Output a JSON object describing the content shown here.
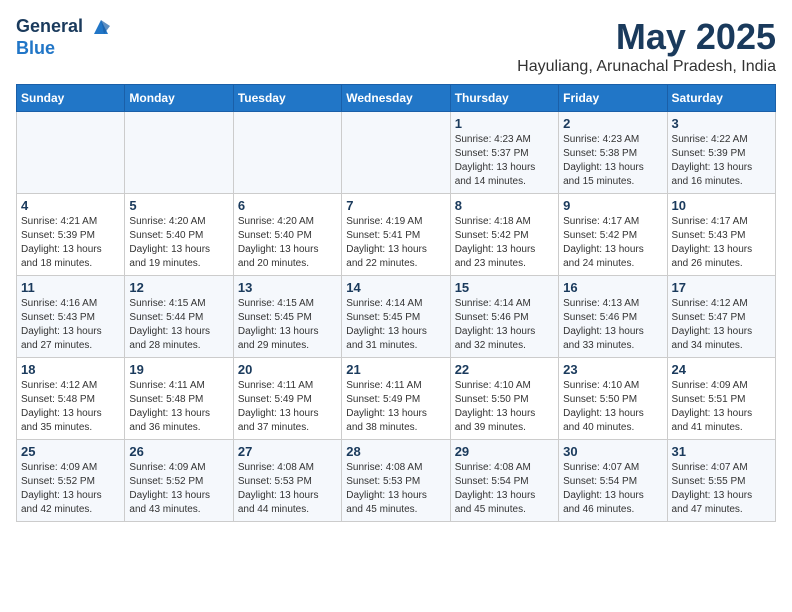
{
  "logo": {
    "line1": "General",
    "line2": "Blue"
  },
  "title": "May 2025",
  "location": "Hayuliang, Arunachal Pradesh, India",
  "weekdays": [
    "Sunday",
    "Monday",
    "Tuesday",
    "Wednesday",
    "Thursday",
    "Friday",
    "Saturday"
  ],
  "weeks": [
    [
      {
        "day": "",
        "detail": ""
      },
      {
        "day": "",
        "detail": ""
      },
      {
        "day": "",
        "detail": ""
      },
      {
        "day": "",
        "detail": ""
      },
      {
        "day": "1",
        "detail": "Sunrise: 4:23 AM\nSunset: 5:37 PM\nDaylight: 13 hours\nand 14 minutes."
      },
      {
        "day": "2",
        "detail": "Sunrise: 4:23 AM\nSunset: 5:38 PM\nDaylight: 13 hours\nand 15 minutes."
      },
      {
        "day": "3",
        "detail": "Sunrise: 4:22 AM\nSunset: 5:39 PM\nDaylight: 13 hours\nand 16 minutes."
      }
    ],
    [
      {
        "day": "4",
        "detail": "Sunrise: 4:21 AM\nSunset: 5:39 PM\nDaylight: 13 hours\nand 18 minutes."
      },
      {
        "day": "5",
        "detail": "Sunrise: 4:20 AM\nSunset: 5:40 PM\nDaylight: 13 hours\nand 19 minutes."
      },
      {
        "day": "6",
        "detail": "Sunrise: 4:20 AM\nSunset: 5:40 PM\nDaylight: 13 hours\nand 20 minutes."
      },
      {
        "day": "7",
        "detail": "Sunrise: 4:19 AM\nSunset: 5:41 PM\nDaylight: 13 hours\nand 22 minutes."
      },
      {
        "day": "8",
        "detail": "Sunrise: 4:18 AM\nSunset: 5:42 PM\nDaylight: 13 hours\nand 23 minutes."
      },
      {
        "day": "9",
        "detail": "Sunrise: 4:17 AM\nSunset: 5:42 PM\nDaylight: 13 hours\nand 24 minutes."
      },
      {
        "day": "10",
        "detail": "Sunrise: 4:17 AM\nSunset: 5:43 PM\nDaylight: 13 hours\nand 26 minutes."
      }
    ],
    [
      {
        "day": "11",
        "detail": "Sunrise: 4:16 AM\nSunset: 5:43 PM\nDaylight: 13 hours\nand 27 minutes."
      },
      {
        "day": "12",
        "detail": "Sunrise: 4:15 AM\nSunset: 5:44 PM\nDaylight: 13 hours\nand 28 minutes."
      },
      {
        "day": "13",
        "detail": "Sunrise: 4:15 AM\nSunset: 5:45 PM\nDaylight: 13 hours\nand 29 minutes."
      },
      {
        "day": "14",
        "detail": "Sunrise: 4:14 AM\nSunset: 5:45 PM\nDaylight: 13 hours\nand 31 minutes."
      },
      {
        "day": "15",
        "detail": "Sunrise: 4:14 AM\nSunset: 5:46 PM\nDaylight: 13 hours\nand 32 minutes."
      },
      {
        "day": "16",
        "detail": "Sunrise: 4:13 AM\nSunset: 5:46 PM\nDaylight: 13 hours\nand 33 minutes."
      },
      {
        "day": "17",
        "detail": "Sunrise: 4:12 AM\nSunset: 5:47 PM\nDaylight: 13 hours\nand 34 minutes."
      }
    ],
    [
      {
        "day": "18",
        "detail": "Sunrise: 4:12 AM\nSunset: 5:48 PM\nDaylight: 13 hours\nand 35 minutes."
      },
      {
        "day": "19",
        "detail": "Sunrise: 4:11 AM\nSunset: 5:48 PM\nDaylight: 13 hours\nand 36 minutes."
      },
      {
        "day": "20",
        "detail": "Sunrise: 4:11 AM\nSunset: 5:49 PM\nDaylight: 13 hours\nand 37 minutes."
      },
      {
        "day": "21",
        "detail": "Sunrise: 4:11 AM\nSunset: 5:49 PM\nDaylight: 13 hours\nand 38 minutes."
      },
      {
        "day": "22",
        "detail": "Sunrise: 4:10 AM\nSunset: 5:50 PM\nDaylight: 13 hours\nand 39 minutes."
      },
      {
        "day": "23",
        "detail": "Sunrise: 4:10 AM\nSunset: 5:50 PM\nDaylight: 13 hours\nand 40 minutes."
      },
      {
        "day": "24",
        "detail": "Sunrise: 4:09 AM\nSunset: 5:51 PM\nDaylight: 13 hours\nand 41 minutes."
      }
    ],
    [
      {
        "day": "25",
        "detail": "Sunrise: 4:09 AM\nSunset: 5:52 PM\nDaylight: 13 hours\nand 42 minutes."
      },
      {
        "day": "26",
        "detail": "Sunrise: 4:09 AM\nSunset: 5:52 PM\nDaylight: 13 hours\nand 43 minutes."
      },
      {
        "day": "27",
        "detail": "Sunrise: 4:08 AM\nSunset: 5:53 PM\nDaylight: 13 hours\nand 44 minutes."
      },
      {
        "day": "28",
        "detail": "Sunrise: 4:08 AM\nSunset: 5:53 PM\nDaylight: 13 hours\nand 45 minutes."
      },
      {
        "day": "29",
        "detail": "Sunrise: 4:08 AM\nSunset: 5:54 PM\nDaylight: 13 hours\nand 45 minutes."
      },
      {
        "day": "30",
        "detail": "Sunrise: 4:07 AM\nSunset: 5:54 PM\nDaylight: 13 hours\nand 46 minutes."
      },
      {
        "day": "31",
        "detail": "Sunrise: 4:07 AM\nSunset: 5:55 PM\nDaylight: 13 hours\nand 47 minutes."
      }
    ]
  ]
}
